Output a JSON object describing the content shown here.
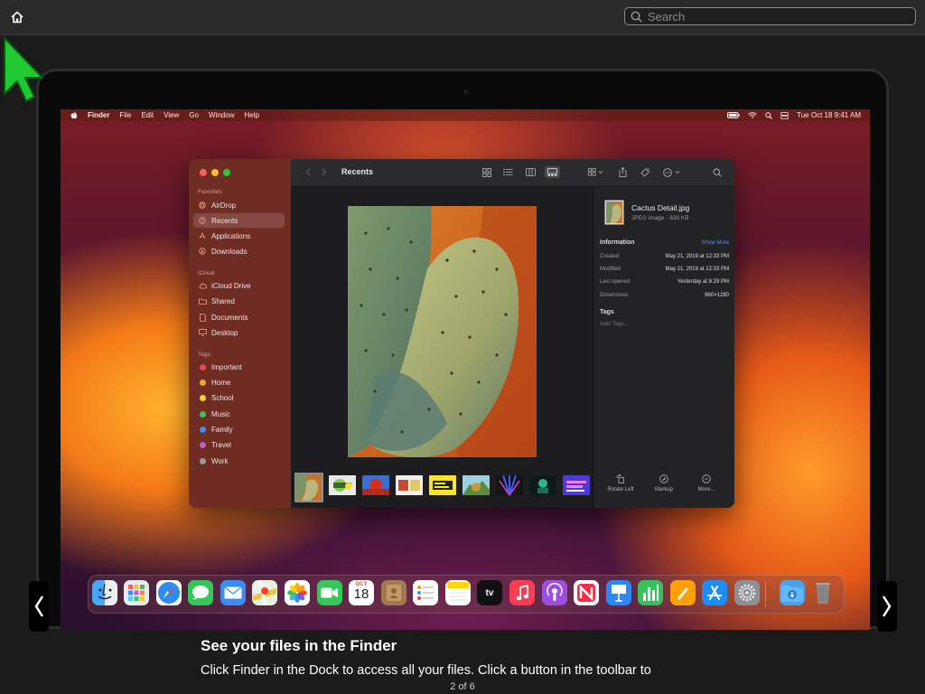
{
  "toolbar": {
    "search_placeholder": "Search",
    "home_icon": "house-icon"
  },
  "menubar": {
    "items": [
      "Finder",
      "File",
      "Edit",
      "View",
      "Go",
      "Window",
      "Help"
    ],
    "clock": "Tue Oct 18  9:41 AM"
  },
  "finder": {
    "title": "Recents",
    "sidebar": {
      "favorites_header": "Favorites",
      "favorites": [
        "AirDrop",
        "Recents",
        "Applications",
        "Downloads"
      ],
      "icloud_header": "iCloud",
      "icloud": [
        "iCloud Drive",
        "Shared",
        "Documents",
        "Desktop"
      ],
      "tags_header": "Tags",
      "tags": [
        {
          "label": "Important",
          "color": "#e5484d"
        },
        {
          "label": "Home",
          "color": "#f5a623"
        },
        {
          "label": "School",
          "color": "#f8d32e"
        },
        {
          "label": "Music",
          "color": "#3bc45a"
        },
        {
          "label": "Family",
          "color": "#3d8bfd"
        },
        {
          "label": "Travel",
          "color": "#c35bd1"
        },
        {
          "label": "Work",
          "color": "#9a9a9a"
        }
      ]
    },
    "inspector": {
      "file_name": "Cactus Detail.jpg",
      "file_kind": "JPEG image - 638 KB",
      "information_header": "Information",
      "show_more": "Show More",
      "rows": [
        {
          "label": "Created",
          "value": "May 21, 2019 at 12:33 PM"
        },
        {
          "label": "Modified",
          "value": "May 21, 2019 at 12:33 PM"
        },
        {
          "label": "Last opened",
          "value": "Yesterday at 8:29 PM"
        },
        {
          "label": "Dimensions",
          "value": "960×1280"
        }
      ],
      "tags_header": "Tags",
      "tags_placeholder": "Add Tags...",
      "actions": [
        "Rotate Left",
        "Markup",
        "More..."
      ]
    }
  },
  "dock": {
    "calendar_month": "OCT",
    "calendar_day": "18",
    "tv_label": "tv"
  },
  "caption": {
    "title": "See your files in the Finder",
    "body": "Click Finder  in the Dock to access all your files. Click a button in the toolbar to"
  },
  "pager": "2 of 6"
}
